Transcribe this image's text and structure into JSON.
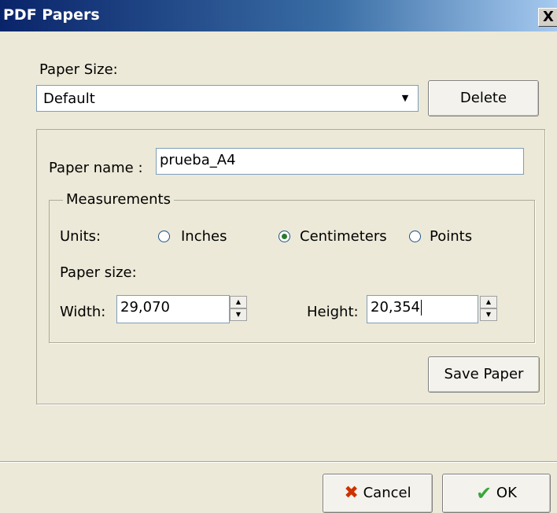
{
  "window": {
    "title": "PDF Papers",
    "close_glyph": "X"
  },
  "paper_size_label": "Paper Size:",
  "paper_size_select": {
    "value": "Default",
    "arrow": "▼"
  },
  "delete_button": "Delete",
  "paper_name": {
    "label": "Paper name :",
    "value": "prueba_A4"
  },
  "measurements": {
    "legend": "Measurements",
    "units_label": "Units:",
    "units": [
      {
        "label": "Inches",
        "selected": false
      },
      {
        "label": "Centimeters",
        "selected": true
      },
      {
        "label": "Points",
        "selected": false
      }
    ],
    "paper_size_label": "Paper size:",
    "width": {
      "label": "Width:",
      "value": "29,070"
    },
    "height": {
      "label": "Height:",
      "value": "20,354"
    }
  },
  "save_paper_button": "Save Paper",
  "footer": {
    "cancel": {
      "label": "Cancel",
      "icon": "x-icon",
      "color": "#cc3300"
    },
    "ok": {
      "label": "OK",
      "icon": "check-icon",
      "color": "#3aa63a"
    }
  }
}
